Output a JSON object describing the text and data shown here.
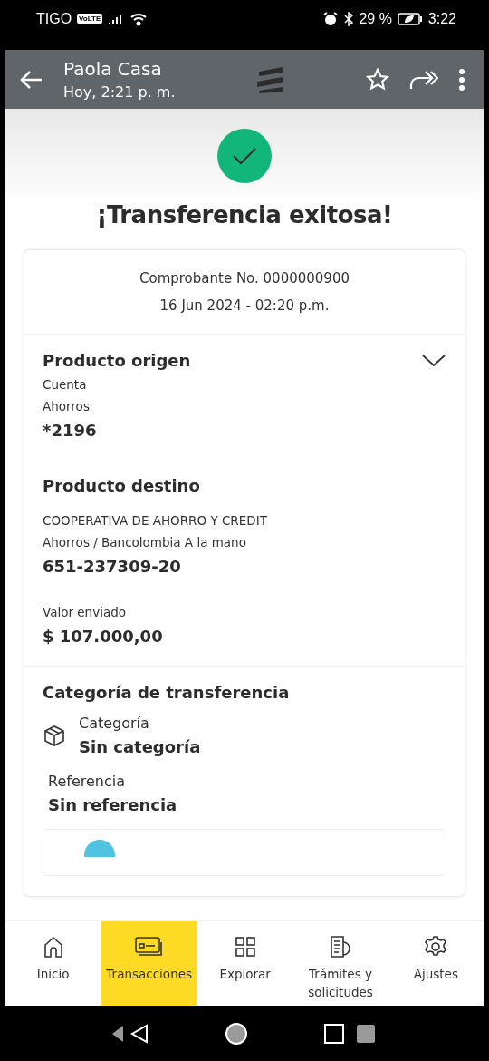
{
  "status_bar": {
    "carrier": "TIGO",
    "network_badge": "VoLTE",
    "battery": "29 %",
    "time": "3:22"
  },
  "viewer": {
    "contact": "Paola Casa",
    "timestamp": "Hoy, 2:21 p. m."
  },
  "success": {
    "title": "¡Transferencia exitosa!"
  },
  "receipt": {
    "number": "Comprobante No. 0000000900",
    "datetime": "16 Jun 2024 - 02:20 p.m."
  },
  "origin": {
    "heading": "Producto origen",
    "expanded": false,
    "lines": [
      "Cuenta",
      "Ahorros"
    ],
    "account": "*2196"
  },
  "destination": {
    "heading": "Producto destino",
    "lines": [
      "COOPERATIVA DE AHORRO Y CREDIT",
      "Ahorros / Bancolombia A la mano"
    ],
    "account": "651-237309-20"
  },
  "amount": {
    "label": "Valor enviado",
    "value": "$ 107.000,00"
  },
  "category": {
    "heading": "Categoría de transferencia",
    "category_label": "Categoría",
    "category_value": "Sin categoría",
    "reference_label": "Referencia",
    "reference_value": "Sin referencia"
  },
  "nav": [
    {
      "kind": "home",
      "label": "Inicio",
      "selected": false
    },
    {
      "kind": "cards",
      "label": "Transacciones",
      "selected": true
    },
    {
      "kind": "grid",
      "label": "Explorar",
      "selected": false
    },
    {
      "kind": "documents",
      "label": "Trámites y solicitudes",
      "selected": false
    },
    {
      "kind": "gear",
      "label": "Ajustes",
      "selected": false
    }
  ]
}
